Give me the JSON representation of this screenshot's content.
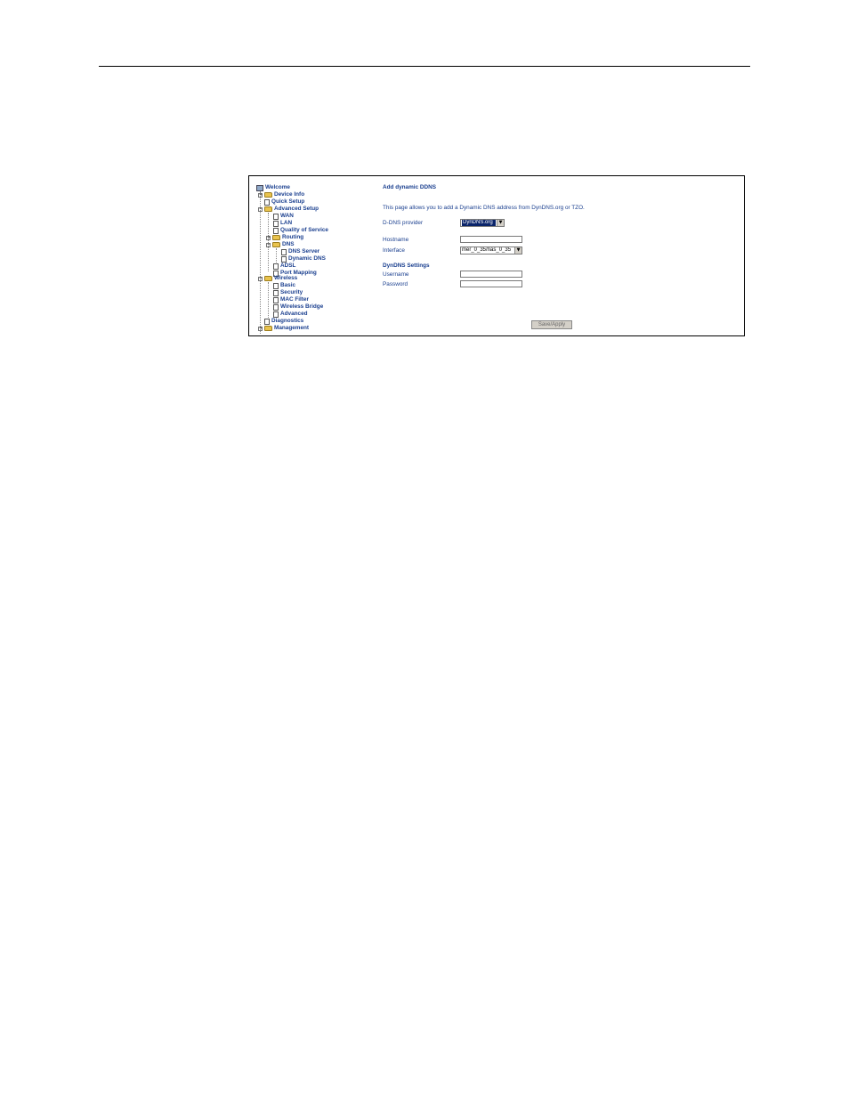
{
  "tree": {
    "welcome": "Welcome",
    "device_info": "Device Info",
    "quick_setup": "Quick Setup",
    "advanced_setup": "Advanced Setup",
    "wan": "WAN",
    "lan": "LAN",
    "qos": "Quality of Service",
    "routing": "Routing",
    "dns": "DNS",
    "dns_server": "DNS Server",
    "dynamic_dns": "Dynamic DNS",
    "adsl": "ADSL",
    "port_mapping": "Port Mapping",
    "wireless": "Wireless",
    "basic": "Basic",
    "security": "Security",
    "mac_filter": "MAC Filter",
    "wireless_bridge": "Wireless Bridge",
    "advanced": "Advanced",
    "diagnostics": "Diagnostics",
    "management": "Management",
    "expand_symbol": "+",
    "collapse_symbol": "−"
  },
  "form": {
    "title": "Add dynamic DDNS",
    "description": "This page allows you to add a Dynamic DNS address from DynDNS.org or TZO.",
    "provider_label": "D-DNS provider",
    "provider_value": "DynDNS.org",
    "hostname_label": "Hostname",
    "hostname_value": "",
    "interface_label": "Interface",
    "interface_value": "mer_0_35/nas_0_35",
    "settings_heading": "DynDNS Settings",
    "username_label": "Username",
    "username_value": "",
    "password_label": "Password",
    "password_value": "",
    "save_label": "Save/Apply",
    "arrow_glyph": "▼"
  }
}
